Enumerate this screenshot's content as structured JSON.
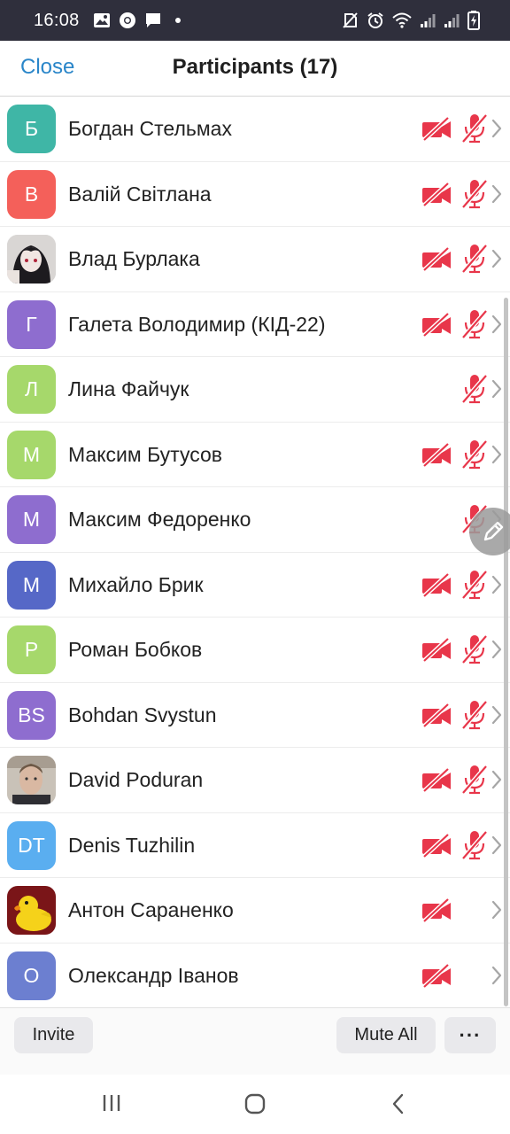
{
  "status_bar": {
    "time": "16:08",
    "left_icons": [
      "image-icon",
      "chrome-icon",
      "chat-icon",
      "dot-icon"
    ],
    "right_icons": [
      "no-sim-icon",
      "alarm-icon",
      "wifi-icon",
      "signal-icon",
      "signal-icon",
      "battery-charging-icon"
    ]
  },
  "header": {
    "close_label": "Close",
    "title": "Participants (17)"
  },
  "participants": [
    {
      "name": "Богдан Стельмах",
      "initial": "Б",
      "color": "#3fb6a6",
      "video_off": true,
      "muted": true
    },
    {
      "name": "Валій Світлана",
      "initial": "В",
      "color": "#f4605a",
      "video_off": true,
      "muted": true
    },
    {
      "name": "Влад Бурлака",
      "initial": "",
      "avatar": "anime-photo",
      "video_off": true,
      "muted": true
    },
    {
      "name": "Галета Володимир (КІД-22)",
      "initial": "Г",
      "color": "#8e6dcf",
      "video_off": true,
      "muted": true
    },
    {
      "name": "Лина Файчук",
      "initial": "Л",
      "color": "#a6d86b",
      "video_off": false,
      "muted": true
    },
    {
      "name": "Максим Бутусов",
      "initial": "М",
      "color": "#a6d86b",
      "video_off": true,
      "muted": true
    },
    {
      "name": "Максим Федоренко",
      "initial": "М",
      "color": "#8e6dcf",
      "video_off": false,
      "muted": true
    },
    {
      "name": "Михайло Брик",
      "initial": "М",
      "color": "#5668c7",
      "video_off": true,
      "muted": true
    },
    {
      "name": "Роман Бобков",
      "initial": "Р",
      "color": "#a6d86b",
      "video_off": true,
      "muted": true
    },
    {
      "name": "Bohdan Svystun",
      "initial": "BS",
      "color": "#8e6dcf",
      "video_off": true,
      "muted": true
    },
    {
      "name": "David Poduran",
      "initial": "",
      "avatar": "face-photo",
      "video_off": true,
      "muted": true
    },
    {
      "name": "Denis Tuzhilin",
      "initial": "DT",
      "color": "#5aaef0",
      "video_off": true,
      "muted": true
    },
    {
      "name": "Антон Сараненко",
      "initial": "",
      "avatar": "duck-photo",
      "video_off": true,
      "muted": false
    },
    {
      "name": "Олександр Іванов",
      "initial": "О",
      "color": "#6c7fd0",
      "video_off": true,
      "muted": false
    }
  ],
  "actions": {
    "invite_label": "Invite",
    "mute_all_label": "Mute All",
    "more_label": "···"
  },
  "colors": {
    "accent": "#2a86c9",
    "icon_red": "#e8364a",
    "status_bar_bg": "#2f2f3c"
  },
  "nav": {
    "icons": [
      "recent-apps-icon",
      "home-icon",
      "back-icon"
    ]
  }
}
